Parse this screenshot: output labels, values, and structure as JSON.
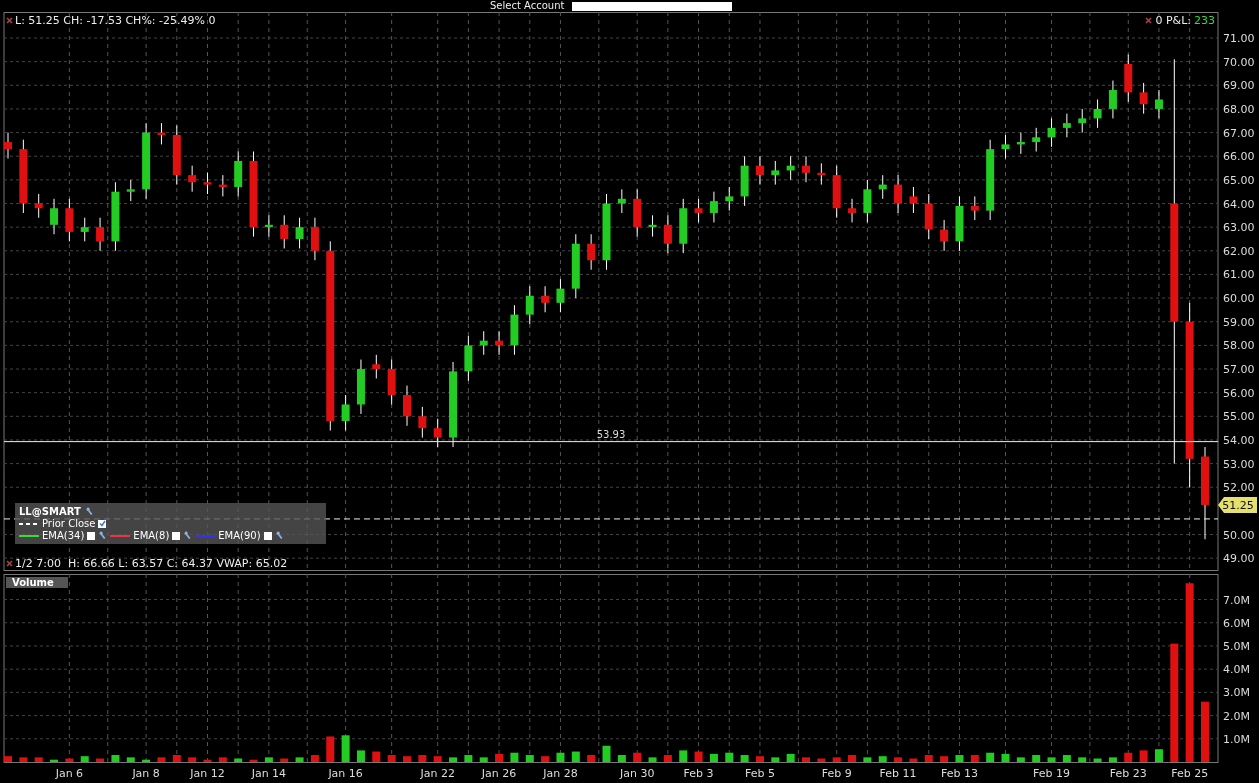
{
  "toolbar": {
    "account_label": "Select Account"
  },
  "price_pane": {
    "quote_line": "L: 51.25 CH: -17.53 CH%: -25.49% 0",
    "pnl": {
      "label": "0 P&L:",
      "value": "233"
    },
    "legend": {
      "title": "LL@SMART",
      "items": [
        {
          "kind": "dashed",
          "label": "Prior Close",
          "color": "#ffffff",
          "checked": true
        },
        {
          "kind": "solid",
          "label": "EMA(34)",
          "color": "#33dd33",
          "checked": false
        },
        {
          "kind": "solid",
          "label": "EMA(8)",
          "color": "#ee3344",
          "checked": false
        },
        {
          "kind": "solid",
          "label": "EMA(90)",
          "color": "#3333ee",
          "checked": false
        }
      ]
    },
    "bar_info": "1/2 7:00  H: 66.66 L: 63.57 C: 64.37 VWAP: 65.02",
    "last_price": "51.25",
    "chart_data": {
      "type": "candlestick",
      "grid": true,
      "ylim": [
        48.5,
        72.1
      ],
      "yticks": [
        {
          "value": 71,
          "label": "71.00"
        },
        {
          "value": 70,
          "label": "70.00"
        },
        {
          "value": 69,
          "label": "69.00"
        },
        {
          "value": 68,
          "label": "68.00"
        },
        {
          "value": 67,
          "label": "67.00"
        },
        {
          "value": 66,
          "label": "66.00"
        },
        {
          "value": 65,
          "label": "65.00"
        },
        {
          "value": 64,
          "label": "64.00"
        },
        {
          "value": 63,
          "label": "63.00"
        },
        {
          "value": 62,
          "label": "62.00"
        },
        {
          "value": 61,
          "label": "61.00"
        },
        {
          "value": 60,
          "label": "60.00"
        },
        {
          "value": 59,
          "label": "59.00"
        },
        {
          "value": 58,
          "label": "58.00"
        },
        {
          "value": 57,
          "label": "57.00"
        },
        {
          "value": 56,
          "label": "56.00"
        },
        {
          "value": 55,
          "label": "55.00"
        },
        {
          "value": 54,
          "label": "54.00"
        },
        {
          "value": 53,
          "label": "53.00"
        },
        {
          "value": 52,
          "label": "52.00"
        },
        {
          "value": 50,
          "label": "50.00"
        },
        {
          "value": 49,
          "label": "49.00"
        }
      ],
      "ohlc": [
        [
          66.6,
          67.0,
          65.9,
          66.3
        ],
        [
          66.3,
          66.7,
          63.6,
          64.0
        ],
        [
          64.0,
          64.4,
          63.4,
          63.8
        ],
        [
          63.1,
          64.2,
          62.7,
          63.8
        ],
        [
          63.8,
          64.2,
          62.4,
          62.8
        ],
        [
          62.8,
          63.4,
          62.4,
          63.0
        ],
        [
          63.0,
          63.4,
          62.0,
          62.4
        ],
        [
          62.4,
          64.9,
          62.0,
          64.5
        ],
        [
          64.5,
          65.0,
          64.1,
          64.6
        ],
        [
          64.6,
          67.4,
          64.2,
          67.0
        ],
        [
          67.0,
          67.4,
          66.5,
          66.9
        ],
        [
          66.9,
          67.3,
          64.8,
          65.2
        ],
        [
          65.2,
          65.6,
          64.5,
          64.9
        ],
        [
          64.9,
          65.3,
          64.4,
          64.8
        ],
        [
          64.8,
          65.2,
          64.3,
          64.7
        ],
        [
          64.7,
          66.2,
          64.3,
          65.8
        ],
        [
          65.8,
          66.2,
          62.6,
          63.0
        ],
        [
          63.0,
          63.5,
          62.6,
          63.1
        ],
        [
          63.1,
          63.5,
          62.1,
          62.5
        ],
        [
          62.5,
          63.4,
          62.1,
          63.0
        ],
        [
          63.0,
          63.4,
          61.6,
          62.0
        ],
        [
          62.0,
          62.4,
          54.4,
          54.8
        ],
        [
          54.8,
          55.9,
          54.4,
          55.5
        ],
        [
          55.5,
          57.4,
          55.1,
          57.0
        ],
        [
          57.2,
          57.6,
          56.6,
          57.0
        ],
        [
          57.0,
          57.4,
          55.5,
          55.9
        ],
        [
          55.9,
          56.3,
          54.6,
          55.0
        ],
        [
          55.0,
          55.4,
          54.1,
          54.5
        ],
        [
          54.5,
          54.9,
          53.7,
          54.1
        ],
        [
          54.1,
          57.3,
          53.7,
          56.9
        ],
        [
          56.9,
          58.4,
          56.5,
          58.0
        ],
        [
          58.0,
          58.6,
          57.6,
          58.2
        ],
        [
          58.2,
          58.6,
          57.6,
          58.0
        ],
        [
          58.0,
          59.7,
          57.6,
          59.3
        ],
        [
          59.3,
          60.5,
          58.9,
          60.1
        ],
        [
          60.1,
          60.5,
          59.4,
          59.8
        ],
        [
          59.8,
          60.8,
          59.4,
          60.4
        ],
        [
          60.4,
          62.7,
          60.0,
          62.3
        ],
        [
          62.3,
          62.7,
          61.2,
          61.6
        ],
        [
          61.6,
          64.4,
          61.2,
          64.0
        ],
        [
          64.0,
          64.6,
          63.6,
          64.2
        ],
        [
          64.2,
          64.6,
          62.6,
          63.0
        ],
        [
          63.0,
          63.5,
          62.6,
          63.1
        ],
        [
          63.1,
          63.5,
          61.9,
          62.3
        ],
        [
          62.3,
          64.2,
          61.9,
          63.8
        ],
        [
          63.8,
          64.2,
          63.2,
          63.6
        ],
        [
          63.6,
          64.5,
          63.2,
          64.1
        ],
        [
          64.1,
          64.7,
          63.7,
          64.3
        ],
        [
          64.3,
          66.0,
          63.9,
          65.6
        ],
        [
          65.6,
          66.0,
          64.8,
          65.2
        ],
        [
          65.2,
          65.8,
          64.8,
          65.4
        ],
        [
          65.4,
          66.0,
          65.0,
          65.6
        ],
        [
          65.6,
          66.0,
          64.9,
          65.3
        ],
        [
          65.3,
          65.7,
          64.8,
          65.2
        ],
        [
          65.2,
          65.6,
          63.4,
          63.8
        ],
        [
          63.8,
          64.2,
          63.2,
          63.6
        ],
        [
          63.6,
          65.0,
          63.2,
          64.6
        ],
        [
          64.6,
          65.2,
          64.2,
          64.8
        ],
        [
          64.8,
          65.2,
          63.6,
          64.0
        ],
        [
          64.3,
          64.7,
          63.6,
          64.0
        ],
        [
          64.0,
          64.4,
          62.5,
          62.9
        ],
        [
          62.9,
          63.3,
          62.0,
          62.4
        ],
        [
          62.4,
          64.3,
          62.0,
          63.9
        ],
        [
          63.9,
          64.3,
          63.3,
          63.7
        ],
        [
          63.7,
          66.7,
          63.3,
          66.3
        ],
        [
          66.3,
          66.9,
          65.9,
          66.5
        ],
        [
          66.5,
          67.0,
          66.1,
          66.6
        ],
        [
          66.6,
          67.2,
          66.2,
          66.8
        ],
        [
          66.8,
          67.6,
          66.4,
          67.2
        ],
        [
          67.2,
          67.8,
          66.8,
          67.4
        ],
        [
          67.4,
          68.0,
          67.0,
          67.6
        ],
        [
          67.6,
          68.4,
          67.2,
          68.0
        ],
        [
          68.0,
          69.2,
          67.6,
          68.8
        ],
        [
          69.9,
          70.3,
          68.3,
          68.7
        ],
        [
          68.7,
          69.1,
          67.8,
          68.2
        ],
        [
          68.0,
          68.8,
          67.6,
          68.4
        ],
        [
          64.0,
          70.1,
          53.0,
          59.0
        ],
        [
          59.0,
          59.8,
          52.0,
          53.2
        ],
        [
          53.3,
          53.7,
          49.8,
          51.25
        ]
      ],
      "ref_lines": [
        {
          "axis": "y",
          "value": 53.93,
          "label": "53.93",
          "color": "#eeeeee"
        },
        {
          "axis": "y",
          "value": 50.66,
          "color": "#eeeeee"
        }
      ]
    }
  },
  "volume_pane": {
    "title": "Volume",
    "chart_data": {
      "type": "bar",
      "grid": true,
      "ylim": [
        0,
        8.1
      ],
      "yticks": [
        {
          "value": 1,
          "label": "1.0M"
        },
        {
          "value": 2,
          "label": "2.0M"
        },
        {
          "value": 3,
          "label": "3.0M"
        },
        {
          "value": 4,
          "label": "4.0M"
        },
        {
          "value": 5,
          "label": "5.0M"
        },
        {
          "value": 6,
          "label": "6.0M"
        },
        {
          "value": 7,
          "label": "7.0M"
        }
      ],
      "categories": [
        null,
        null,
        null,
        null,
        "Jan 6",
        null,
        null,
        null,
        null,
        "Jan 8",
        null,
        null,
        null,
        "Jan 12",
        null,
        null,
        null,
        "Jan 14",
        null,
        null,
        null,
        null,
        "Jan 16",
        null,
        null,
        null,
        null,
        null,
        "Jan 22",
        null,
        null,
        null,
        "Jan 26",
        null,
        null,
        null,
        "Jan 28",
        null,
        null,
        null,
        null,
        "Jan 30",
        null,
        null,
        null,
        "Feb 3",
        null,
        null,
        null,
        "Feb 5",
        null,
        null,
        null,
        null,
        "Feb 9",
        null,
        null,
        null,
        "Feb 11",
        null,
        null,
        null,
        "Feb 13",
        null,
        null,
        null,
        null,
        null,
        "Feb 19",
        null,
        null,
        null,
        null,
        "Feb 23",
        null,
        null,
        null,
        "Feb 25",
        null
      ],
      "values": [
        0.25,
        0.2,
        0.2,
        0.1,
        0.15,
        0.25,
        0.15,
        0.3,
        0.2,
        0.1,
        0.2,
        0.3,
        0.2,
        0.1,
        0.2,
        0.15,
        0.1,
        0.2,
        0.15,
        0.2,
        0.3,
        1.1,
        1.15,
        0.5,
        0.45,
        0.3,
        0.25,
        0.3,
        0.25,
        0.2,
        0.3,
        0.2,
        0.35,
        0.4,
        0.3,
        0.25,
        0.4,
        0.45,
        0.3,
        0.7,
        0.3,
        0.4,
        0.2,
        0.3,
        0.5,
        0.45,
        0.35,
        0.4,
        0.3,
        0.25,
        0.2,
        0.35,
        0.2,
        0.15,
        0.2,
        0.3,
        0.2,
        0.25,
        0.2,
        0.15,
        0.3,
        0.25,
        0.3,
        0.3,
        0.4,
        0.35,
        0.2,
        0.3,
        0.2,
        0.3,
        0.2,
        0.15,
        0.2,
        0.4,
        0.5,
        0.55,
        5.1,
        7.7,
        2.6
      ]
    }
  }
}
